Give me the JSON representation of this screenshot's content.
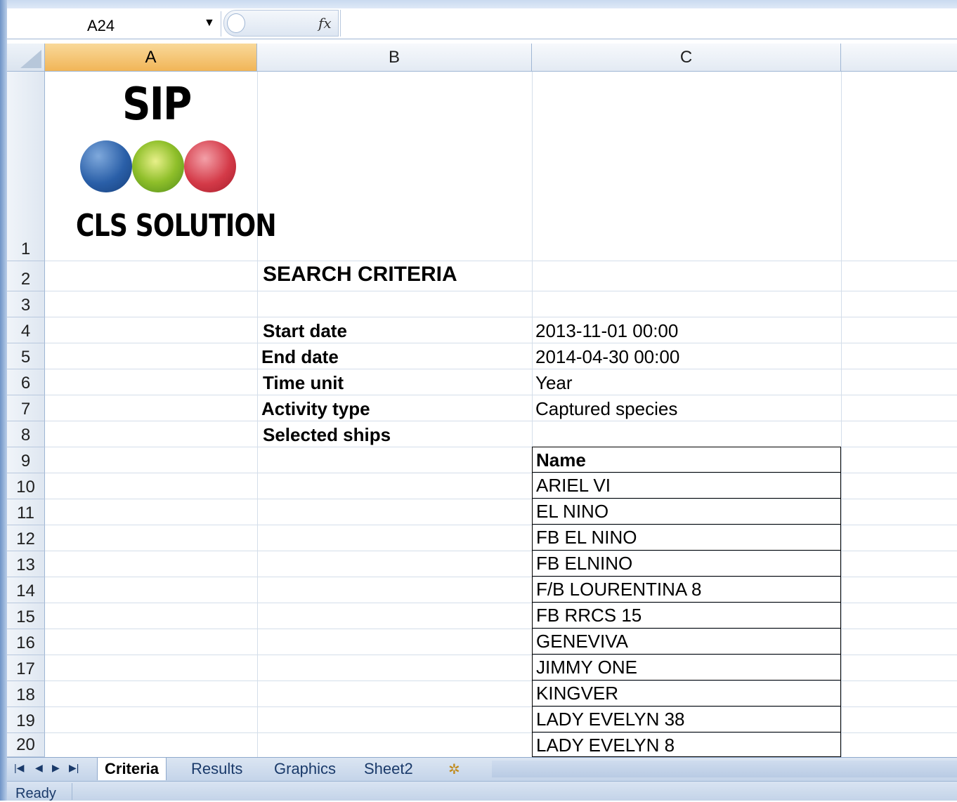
{
  "formula_bar": {
    "name_box": "A24",
    "fx_label": "fx",
    "formula": ""
  },
  "columns": [
    "A",
    "B",
    "C"
  ],
  "rows": [
    "1",
    "2",
    "3",
    "4",
    "5",
    "6",
    "7",
    "8",
    "9",
    "10",
    "11",
    "12",
    "13",
    "14",
    "15",
    "16",
    "17",
    "18",
    "19",
    "20"
  ],
  "logo": {
    "top_text": "SIP",
    "bottom_text": "CLS SOLUTION",
    "ball_colors": [
      "#2a5fa8",
      "#8fbf2a",
      "#d43a48"
    ]
  },
  "criteria": {
    "title": "SEARCH CRITERIA",
    "start_label": "Start date",
    "start_value": "2013-11-01 00:00",
    "end_label": "End date",
    "end_value": "2014-04-30 00:00",
    "time_unit_label": "Time unit",
    "time_unit_value": "Year",
    "activity_label": "Activity type",
    "activity_value": "Captured species",
    "ships_label": "Selected ships"
  },
  "ships": {
    "header": "Name",
    "names": [
      "ARIEL VI",
      "EL NINO",
      "FB EL NINO",
      "FB ELNINO",
      "F/B LOURENTINA 8",
      "FB RRCS 15",
      "GENEVIVA",
      "JIMMY ONE",
      "KINGVER",
      "LADY EVELYN 38",
      "LADY EVELYN 8"
    ]
  },
  "sheet_tabs": [
    {
      "label": "Criteria",
      "active": true
    },
    {
      "label": "Results",
      "active": false
    },
    {
      "label": "Graphics",
      "active": false
    },
    {
      "label": "Sheet2",
      "active": false
    }
  ],
  "status": "Ready"
}
